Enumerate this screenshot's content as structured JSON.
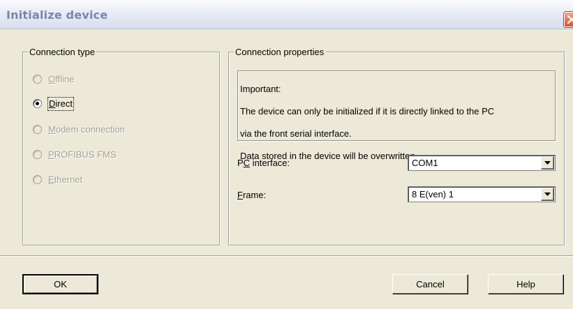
{
  "window": {
    "title": "Initialize device"
  },
  "connection_type": {
    "legend": "Connection type",
    "options": [
      {
        "mnemonic": "O",
        "rest": "ffline",
        "selected": false,
        "enabled": false
      },
      {
        "mnemonic": "D",
        "rest": "irect",
        "selected": true,
        "enabled": true
      },
      {
        "mnemonic": "M",
        "rest": "odem connection",
        "selected": false,
        "enabled": false
      },
      {
        "mnemonic": "P",
        "rest": "ROFIBUS FMS",
        "selected": false,
        "enabled": false
      },
      {
        "mnemonic": "E",
        "rest": "thernet",
        "selected": false,
        "enabled": false
      }
    ]
  },
  "connection_properties": {
    "legend": "Connection properties",
    "info_lines": [
      "Important:",
      "The device can only be initialized if it is directly linked to the PC",
      "via the front serial interface.",
      "Data stored in the device will be overwritten."
    ],
    "pc_interface": {
      "label_before": "P",
      "label_mnemonic": "C",
      "label_after": " interface:",
      "value": "COM1"
    },
    "frame": {
      "label_mnemonic": "F",
      "label_after": "rame:",
      "value": "8 E(ven) 1"
    }
  },
  "buttons": {
    "ok": "OK",
    "cancel": "Cancel",
    "help": "Help"
  },
  "colors": {
    "dialog_bg": "#ece9d8",
    "title_text": "#7787ab",
    "disabled_text": "#a2a195",
    "close_red": "#d8542d"
  },
  "icons": {
    "close": "close-x-icon",
    "dropdown": "chevron-down-icon"
  }
}
